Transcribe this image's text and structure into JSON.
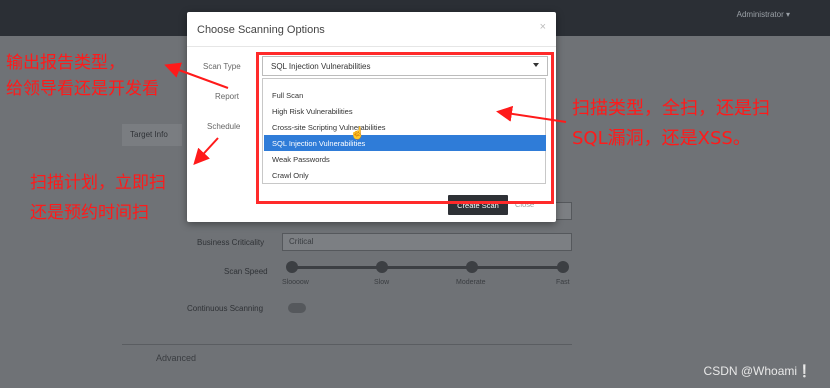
{
  "header": {
    "user_menu": "Administrator ▾"
  },
  "background_form": {
    "tab_label": "Target Info",
    "business_criticality_label": "Business Criticality",
    "business_criticality_value": "Critical",
    "scan_speed_label": "Scan Speed",
    "scan_speed_options": [
      "Sloooow",
      "Slow",
      "Moderate",
      "Fast"
    ],
    "scan_speed_selected_index": 3,
    "continuous_scanning_label": "Continuous Scanning",
    "advanced_label": "Advanced"
  },
  "modal": {
    "title": "Choose Scanning Options",
    "close_glyph": "×",
    "scan_type_label": "Scan Type",
    "report_label": "Report",
    "schedule_label": "Schedule",
    "scan_type_value": "SQL Injection Vulnerabilities",
    "scan_type_options": [
      "Full Scan",
      "High Risk Vulnerabilities",
      "Cross-site Scripting Vulnerabilities",
      "SQL Injection Vulnerabilities",
      "Weak Passwords",
      "Crawl Only"
    ],
    "selected_option_index": 3,
    "create_button": "Create Scan",
    "close_button": "Close"
  },
  "annotations": {
    "report_note_line1": "输出报告类型，",
    "report_note_line2": "给领导看还是开发看",
    "schedule_note_line1": "扫描计划，立即扫",
    "schedule_note_line2": "还是预约时间扫",
    "scan_type_note_line1": "扫描类型，全扫，还是扫",
    "scan_type_note_line2": "SQL漏洞，还是XSS。",
    "color": "#ff1a1a"
  },
  "watermark": "CSDN @Whoami❕",
  "colors": {
    "selected_option": "#2f7cd8",
    "annotation_red": "#ff2a2a",
    "overlay": "#5f6266"
  }
}
